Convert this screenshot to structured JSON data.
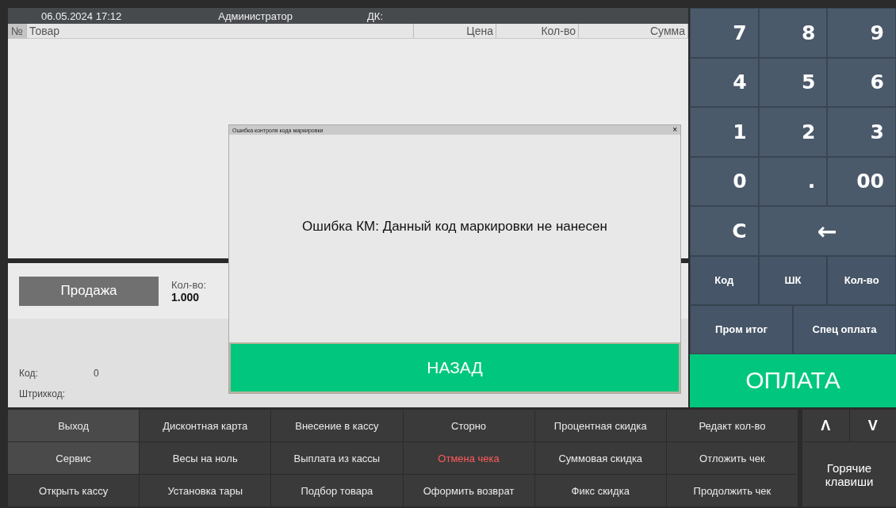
{
  "header": {
    "datetime": "06.05.2024 17:12",
    "user": "Администратор",
    "card_label": "ДК:"
  },
  "table": {
    "columns": [
      "№",
      "Товар",
      "Цена",
      "Кол-во",
      "Сумма"
    ]
  },
  "sale_panel": {
    "mode_button": "Продажа",
    "qty_label": "Кол-во:",
    "qty_value": "1.000",
    "code_label": "Код:",
    "code_value": "0",
    "barcode_label": "Штрихкод:"
  },
  "dialog": {
    "title": "Ошибка контроля кода маркировки",
    "close": "×",
    "message": "Ошибка КМ: Данный код маркировки не нанесен",
    "button": "НАЗАД"
  },
  "keypad": {
    "keys": [
      {
        "label": "7",
        "kind": "digit"
      },
      {
        "label": "8",
        "kind": "digit"
      },
      {
        "label": "9",
        "kind": "digit"
      },
      {
        "label": "4",
        "kind": "digit"
      },
      {
        "label": "5",
        "kind": "digit"
      },
      {
        "label": "6",
        "kind": "digit"
      },
      {
        "label": "1",
        "kind": "digit"
      },
      {
        "label": "2",
        "kind": "digit"
      },
      {
        "label": "3",
        "kind": "digit"
      },
      {
        "label": "0",
        "kind": "digit"
      },
      {
        "label": ".",
        "kind": "digit"
      },
      {
        "label": "00",
        "kind": "digit"
      },
      {
        "label": "C",
        "kind": "digit"
      },
      {
        "label": "←",
        "kind": "wide"
      }
    ],
    "modes": [
      "Код",
      "ШК",
      "Кол-во"
    ],
    "totals": [
      "Пром итог",
      "Спец оплата"
    ],
    "pay": "ОПЛАТА"
  },
  "functions": [
    {
      "label": "Выход",
      "kind": "light"
    },
    {
      "label": "Дисконтная карта",
      "kind": "normal"
    },
    {
      "label": "Внесение в кассу",
      "kind": "normal"
    },
    {
      "label": "Сторно",
      "kind": "normal"
    },
    {
      "label": "Процентная скидка",
      "kind": "normal"
    },
    {
      "label": "Редакт кол-во",
      "kind": "normal"
    },
    {
      "label": "Сервис",
      "kind": "light"
    },
    {
      "label": "Весы на ноль",
      "kind": "normal"
    },
    {
      "label": "Выплата из кассы",
      "kind": "normal"
    },
    {
      "label": "Отмена чека",
      "kind": "danger"
    },
    {
      "label": "Суммовая скидка",
      "kind": "normal"
    },
    {
      "label": "Отложить чек",
      "kind": "normal"
    },
    {
      "label": "Открыть кассу",
      "kind": "normal"
    },
    {
      "label": "Установка тары",
      "kind": "normal"
    },
    {
      "label": "Подбор товара",
      "kind": "normal"
    },
    {
      "label": "Оформить возврат",
      "kind": "normal"
    },
    {
      "label": "Фикс скидка",
      "kind": "normal"
    },
    {
      "label": "Продолжить чек",
      "kind": "normal"
    }
  ],
  "scroll_keys": [
    "Λ",
    "V"
  ],
  "hotkeys": "Горячие клавиши"
}
